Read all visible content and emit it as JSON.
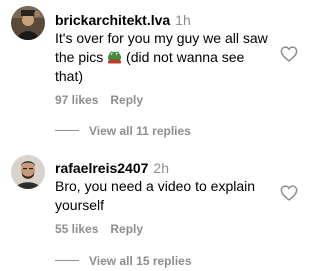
{
  "comments": [
    {
      "username": "brickarchitekt.lva",
      "time": "1h",
      "text_before_emoji": "It's over for you my guy we all saw the pics ",
      "emoji": "pepe-frog-emoji",
      "text_after_emoji": " (did not wanna see that)",
      "likes": "97 likes",
      "reply_label": "Reply",
      "view_replies": "View all 11 replies",
      "avatar": "avatar-dark-figure"
    },
    {
      "username": "rafaelreis2407",
      "time": "2h",
      "text": "Bro, you need a video to explain yourself",
      "likes": "55 likes",
      "reply_label": "Reply",
      "view_replies": "View all 15 replies",
      "avatar": "avatar-man-beard"
    }
  ],
  "icons": {
    "like": "heart-outline-icon"
  },
  "colors": {
    "secondary_text": "#8e8e8e",
    "primary_text": "#000000",
    "background": "#ffffff"
  }
}
